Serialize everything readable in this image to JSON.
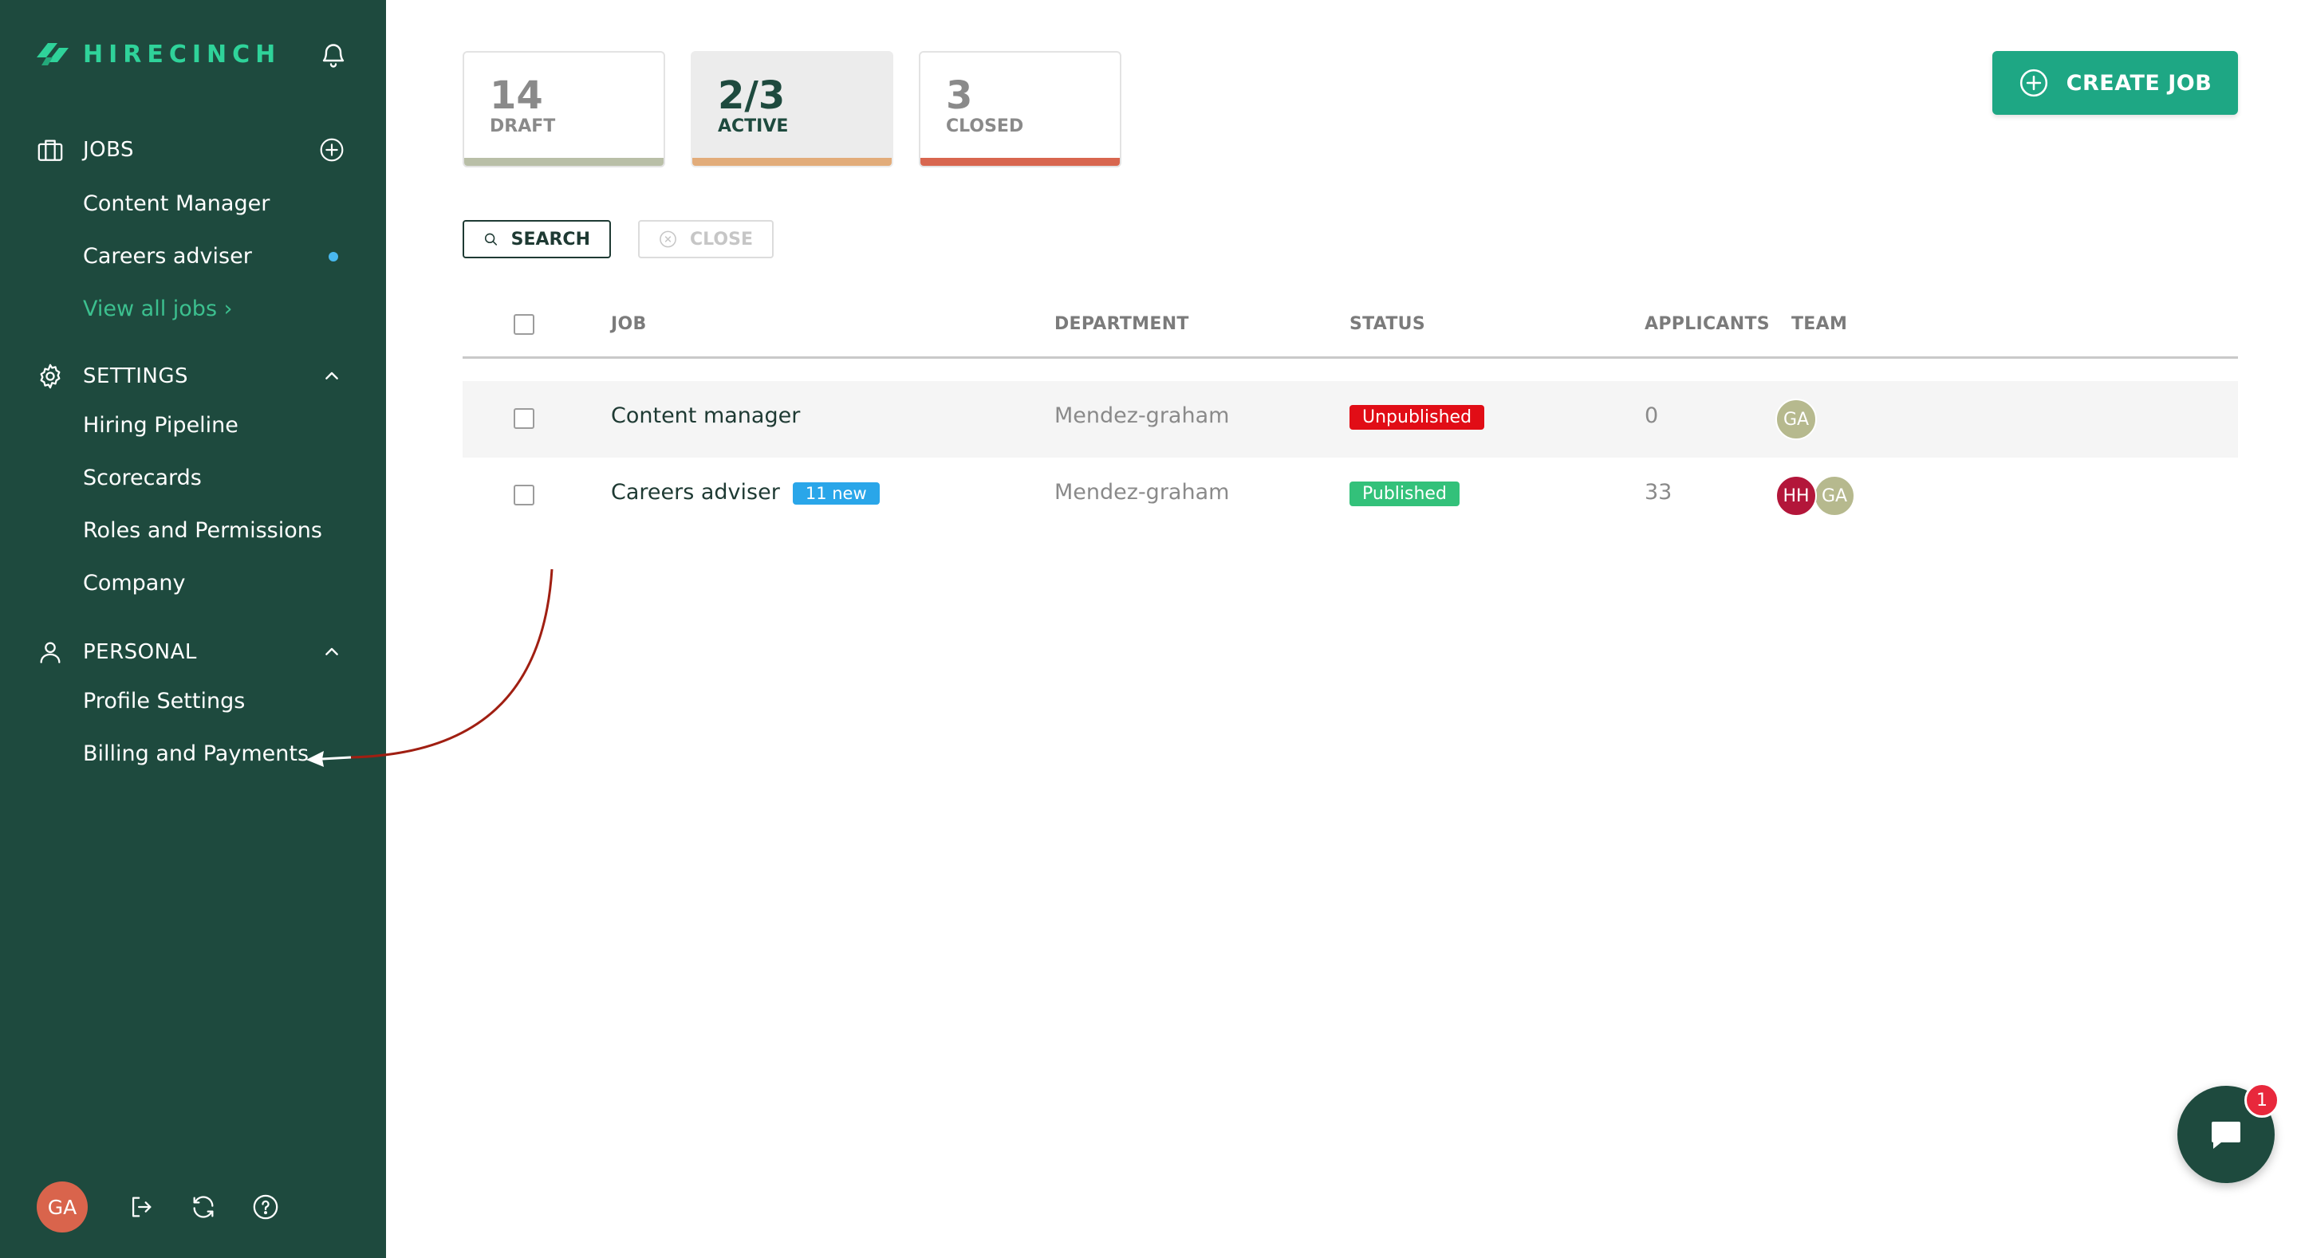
{
  "app": {
    "brand": "HIRECINCH"
  },
  "sidebar": {
    "jobs": {
      "label": "JOBS",
      "items": [
        {
          "label": "Content Manager",
          "has_dot": false
        },
        {
          "label": "Careers adviser",
          "has_dot": true
        }
      ],
      "view_all": "View all jobs ›"
    },
    "settings": {
      "label": "SETTINGS",
      "items": [
        "Hiring Pipeline",
        "Scorecards",
        "Roles and Permissions",
        "Company"
      ]
    },
    "personal": {
      "label": "PERSONAL",
      "items": [
        "Profile Settings",
        "Billing and Payments"
      ]
    },
    "user_initials": "GA"
  },
  "stats": [
    {
      "num": "14",
      "label": "DRAFT",
      "color": "#b9bfa7",
      "active": false
    },
    {
      "num": "2/3",
      "label": "ACTIVE",
      "color": "#e2ac7a",
      "active": true
    },
    {
      "num": "3",
      "label": "CLOSED",
      "color": "#d8664f",
      "active": false
    }
  ],
  "toolbar": {
    "create_label": "CREATE JOB",
    "search_label": "SEARCH",
    "close_label": "CLOSE"
  },
  "table": {
    "headers": {
      "job": "JOB",
      "department": "DEPARTMENT",
      "status": "STATUS",
      "applicants": "APPLICANTS",
      "team": "TEAM"
    },
    "rows": [
      {
        "job": "Content manager",
        "new_badge": "",
        "department": "Mendez-graham",
        "status": "Unpublished",
        "status_color": "#e10d16",
        "applicants": "0",
        "team": [
          {
            "initials": "GA",
            "color": "#b6b98e"
          }
        ]
      },
      {
        "job": "Careers adviser",
        "new_badge": "11 new",
        "department": "Mendez-graham",
        "status": "Published",
        "status_color": "#33c17a",
        "applicants": "33",
        "team": [
          {
            "initials": "HH",
            "color": "#b3163a"
          },
          {
            "initials": "GA",
            "color": "#b6b98e"
          }
        ]
      }
    ]
  },
  "chat": {
    "unread": "1"
  },
  "colors": {
    "sidebar_bg": "#1e4a3e",
    "accent": "#1ea784",
    "annotation_arrow": "#a01f12"
  }
}
